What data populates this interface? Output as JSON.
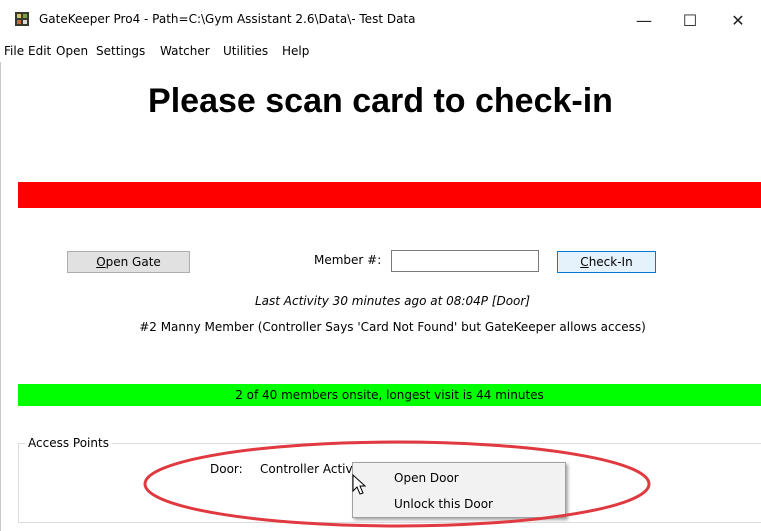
{
  "window": {
    "title": "GateKeeper Pro4 - Path=C:\\Gym Assistant 2.6\\Data\\- Test Data",
    "minimize_glyph": "—",
    "maximize_glyph": "☐",
    "close_glyph": "✕"
  },
  "menu": [
    "File",
    "Edit",
    "Open",
    "Settings",
    "Watcher",
    "Utilities",
    "Help"
  ],
  "main": {
    "heading": "Please scan card to check-in",
    "open_gate": {
      "accel": "O",
      "rest": "pen Gate"
    },
    "member_label": "Member #:",
    "member_value": "",
    "check_in": {
      "accel": "C",
      "rest": "heck-In"
    },
    "last_activity": "Last Activity 30 minutes ago at 08:04P [Door]",
    "member_line": "#2 Manny Member (Controller Says 'Card Not Found' but GateKeeper allows access)",
    "onsite": "2 of 40 members onsite, longest visit is 44 minutes"
  },
  "access_points": {
    "title": "Access Points",
    "door_label": "Door:",
    "door_status": "Controller Active"
  },
  "context_menu": {
    "items": [
      "Open Door",
      "Unlock this Door"
    ]
  },
  "colors": {
    "alert_bar": "#ff0000",
    "onsite_bar": "#00ff00",
    "annotation_ellipse": "#e0393f",
    "check_in_border": "#0078d7",
    "check_in_fill": "#e5f1fb"
  },
  "icons": {
    "app": "gatekeeper-app-icon",
    "cursor": "mouse-pointer-icon"
  }
}
